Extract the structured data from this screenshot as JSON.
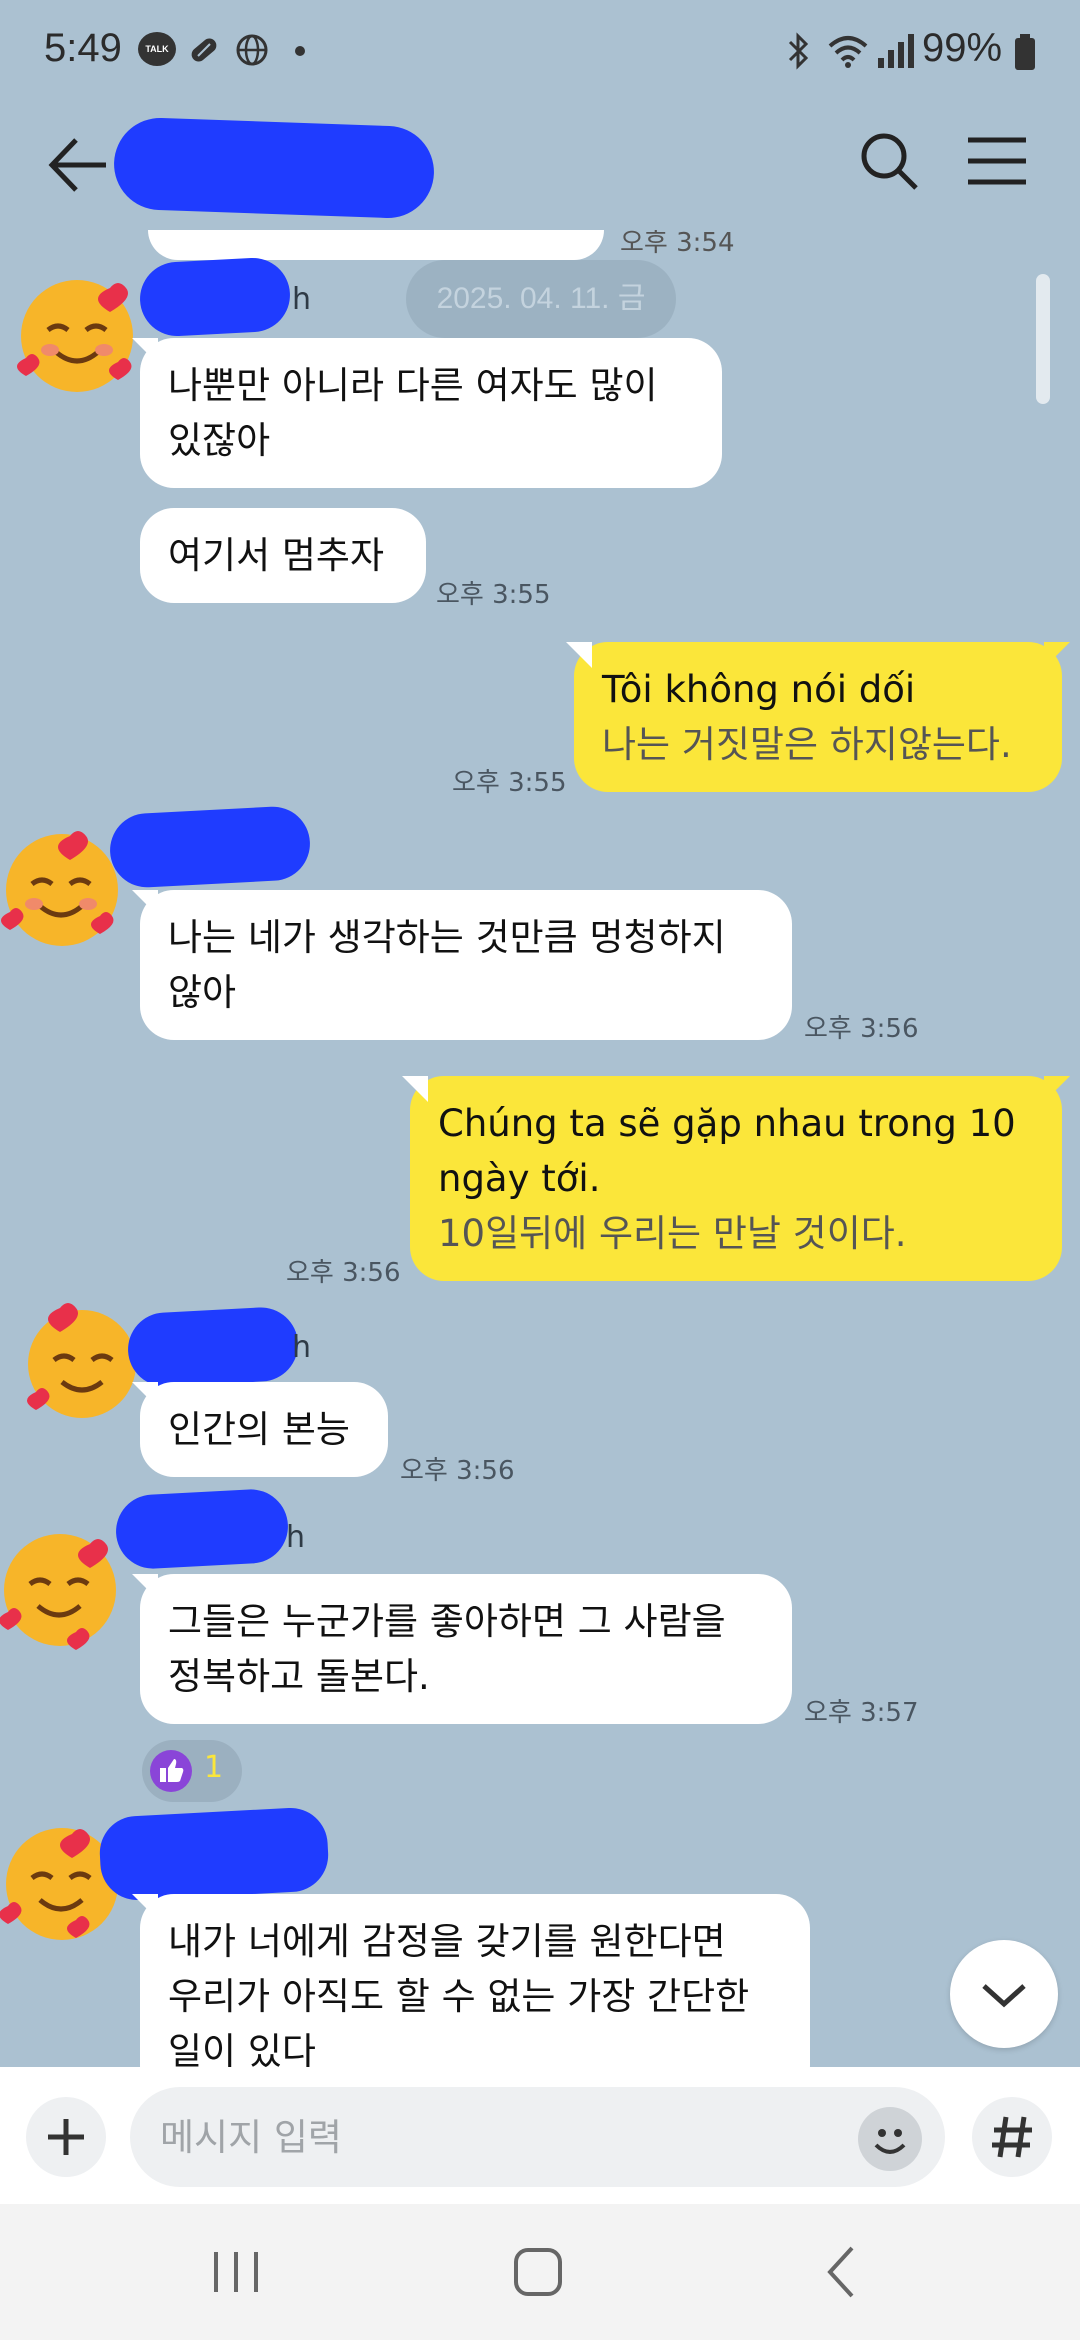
{
  "status_bar": {
    "time": "5:49",
    "talk_badge": "TALK",
    "battery": "99%"
  },
  "chat": {
    "date_chip": "2025. 04. 11. 금",
    "partial_time": "오후 3:54",
    "messages": [
      {
        "id": "m1",
        "sender": "other",
        "name_suffix": "h",
        "lines": [
          "나뿐만 아니라 다른 여자도 많이",
          "있잖아"
        ]
      },
      {
        "id": "m2",
        "sender": "other",
        "lines": [
          "여기서 멈추자"
        ],
        "time": "오후 3:55"
      },
      {
        "id": "m3",
        "sender": "me",
        "lines": [
          "Tôi không nói dối"
        ],
        "translation": [
          "나는 거짓말은 하지않는다."
        ],
        "time": "오후 3:55"
      },
      {
        "id": "m4",
        "sender": "other",
        "lines": [
          "나는 네가 생각하는 것만큼 멍청하지",
          "않아"
        ],
        "time": "오후 3:56"
      },
      {
        "id": "m5",
        "sender": "me",
        "lines": [
          "Chúng ta sẽ gặp nhau trong 10",
          "ngày tới."
        ],
        "translation": [
          "10일뒤에 우리는 만날 것이다."
        ],
        "time": "오후 3:56"
      },
      {
        "id": "m6",
        "sender": "other",
        "name_suffix": "h",
        "lines": [
          "인간의 본능"
        ],
        "time": "오후 3:56"
      },
      {
        "id": "m7",
        "sender": "other",
        "name_suffix": "h",
        "lines": [
          "그들은 누군가를 좋아하면 그 사람을",
          "정복하고 돌본다."
        ],
        "time": "오후 3:57",
        "reaction_count": "1"
      },
      {
        "id": "m8",
        "sender": "other",
        "lines": [
          "내가 너에게 감정을 갖기를 원한다면",
          "우리가 아직도 할 수 없는 가장 간단한",
          "일이 있다"
        ]
      }
    ]
  },
  "input": {
    "placeholder": "메시지 입력",
    "value": ""
  },
  "colors": {
    "background": "#abc1d1",
    "my_bubble": "#fbe63a",
    "other_bubble": "#ffffff",
    "redaction": "#1f3cff"
  },
  "icons": {
    "back": "arrow-left-icon",
    "search": "search-icon",
    "menu": "hamburger-menu-icon",
    "plus": "plus-icon",
    "emoji": "emoji-icon",
    "hash": "hash-icon",
    "scroll_down": "chevron-down-icon",
    "reaction": "thumbs-up-icon"
  }
}
